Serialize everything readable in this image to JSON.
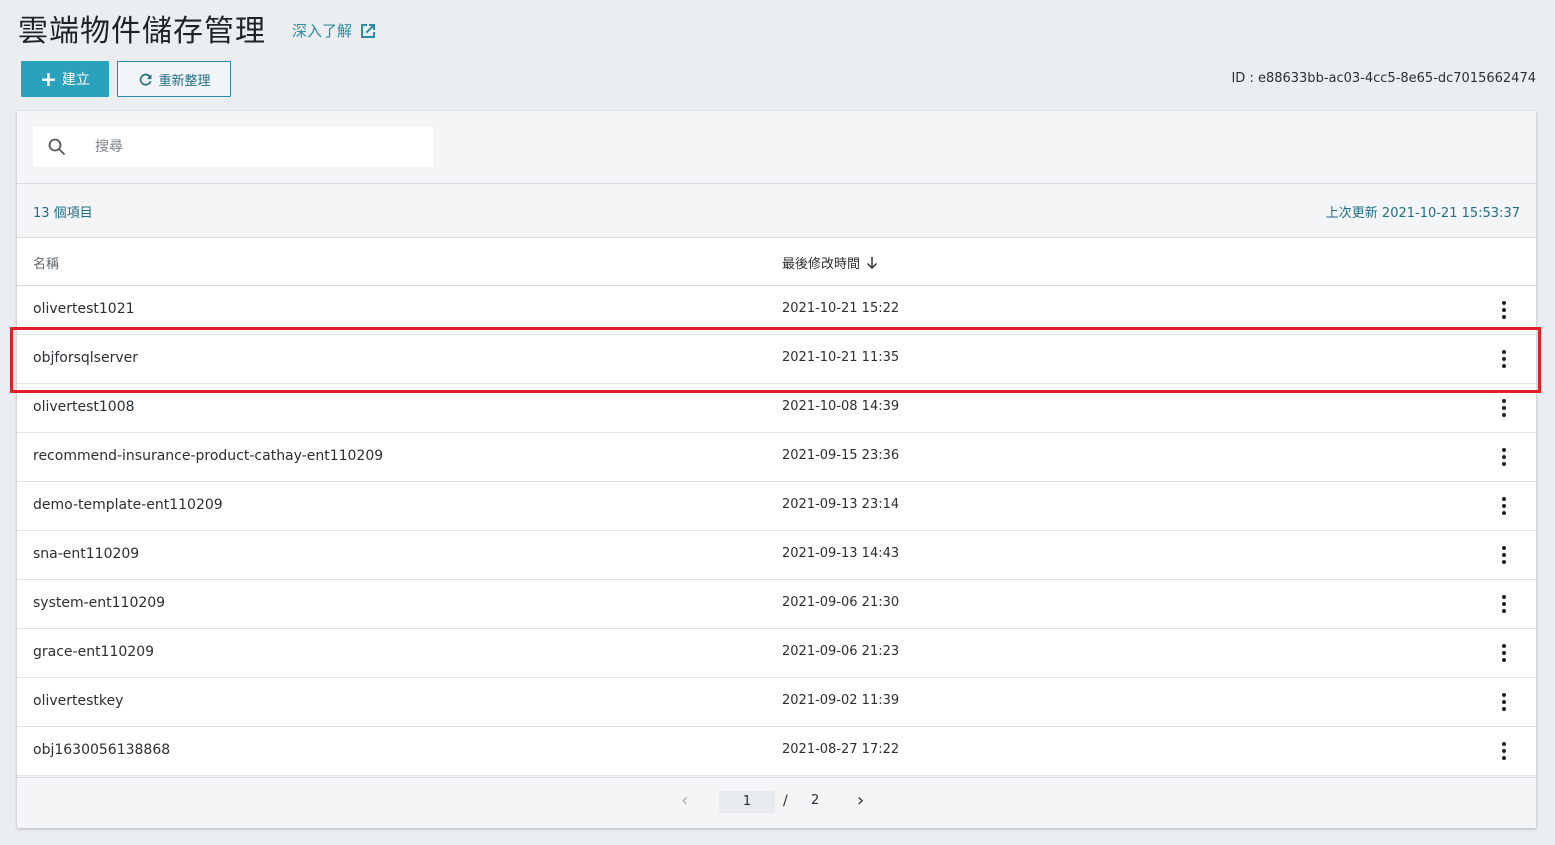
{
  "header": {
    "title": "雲端物件儲存管理",
    "learn_more": "深入了解",
    "create_label": "建立",
    "refresh_label": "重新整理",
    "id_text": "ID : e88633bb-ac03-4cc5-8e65-dc7015662474"
  },
  "search": {
    "placeholder": "搜尋"
  },
  "summary": {
    "item_count": "13 個項目",
    "last_update": "上次更新 2021-10-21 15:53:37"
  },
  "table": {
    "columns": {
      "name": "名稱",
      "modified": "最後修改時間"
    },
    "rows": [
      {
        "name": "olivertest1021",
        "modified": "2021-10-21 15:22"
      },
      {
        "name": "objforsqlserver",
        "modified": "2021-10-21 11:35"
      },
      {
        "name": "olivertest1008",
        "modified": "2021-10-08 14:39"
      },
      {
        "name": "recommend-insurance-product-cathay-ent110209",
        "modified": "2021-09-15 23:36"
      },
      {
        "name": "demo-template-ent110209",
        "modified": "2021-09-13 23:14"
      },
      {
        "name": "sna-ent110209",
        "modified": "2021-09-13 14:43"
      },
      {
        "name": "system-ent110209",
        "modified": "2021-09-06 21:30"
      },
      {
        "name": "grace-ent110209",
        "modified": "2021-09-06 21:23"
      },
      {
        "name": "olivertestkey",
        "modified": "2021-09-02 11:39"
      },
      {
        "name": "obj1630056138868",
        "modified": "2021-08-27 17:22"
      }
    ]
  },
  "pagination": {
    "current": "1",
    "separator": "/",
    "total": "2"
  },
  "colors": {
    "accent": "#2ba2bb",
    "link": "#1f6f85",
    "highlight": "#e1202b"
  }
}
